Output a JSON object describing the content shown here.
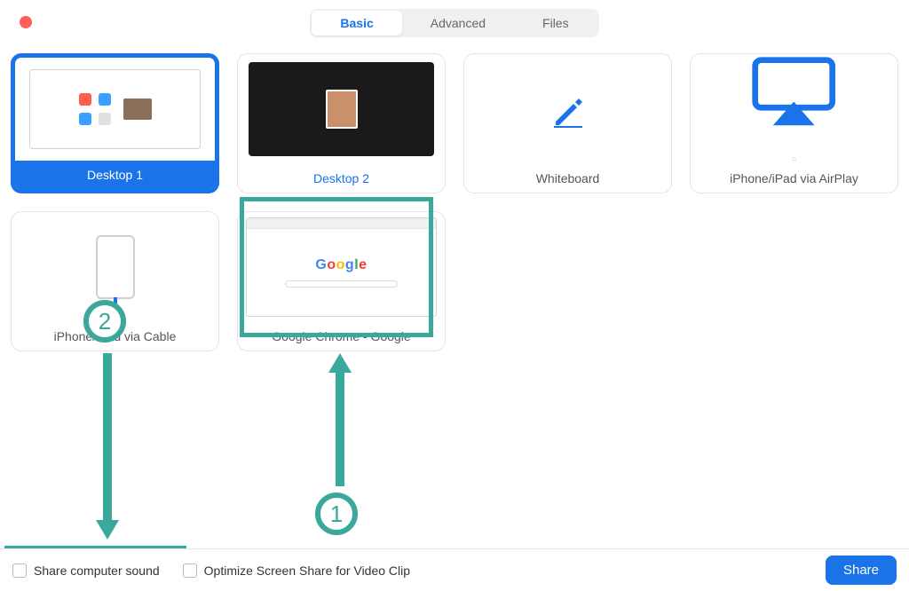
{
  "tabs": {
    "basic": "Basic",
    "advanced": "Advanced",
    "files": "Files",
    "active": "basic"
  },
  "sources": {
    "desktop1": "Desktop 1",
    "desktop2": "Desktop 2",
    "whiteboard": "Whiteboard",
    "airplay": "iPhone/iPad via AirPlay",
    "cable": "iPhone/iPad via Cable",
    "chrome": "Google Chrome - Google"
  },
  "footer": {
    "share_sound": "Share computer sound",
    "optimize": "Optimize Screen Share for Video Clip",
    "share_button": "Share"
  },
  "annotations": {
    "step1": "1",
    "step2": "2"
  },
  "colors": {
    "primary": "#1a73e8",
    "annotation": "#3aa89a"
  }
}
